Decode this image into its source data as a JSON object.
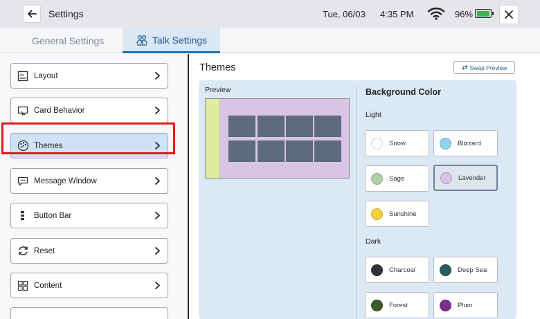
{
  "topbar": {
    "title": "Settings",
    "date": "Tue, 06/03",
    "time": "4:35 PM",
    "battery": "96%",
    "battery_level": 0.96
  },
  "tabs": [
    {
      "label": "General Settings",
      "active": false
    },
    {
      "label": "Talk Settings",
      "active": true
    }
  ],
  "sidebar": {
    "items": [
      {
        "label": "Layout",
        "icon": "layout-icon"
      },
      {
        "label": "Card Behavior",
        "icon": "card-behavior-icon"
      },
      {
        "label": "Themes",
        "icon": "palette-icon",
        "selected": true
      },
      {
        "label": "Message Window",
        "icon": "message-icon"
      },
      {
        "label": "Button Bar",
        "icon": "button-bar-icon"
      },
      {
        "label": "Reset",
        "icon": "reset-icon"
      },
      {
        "label": "Content",
        "icon": "content-icon"
      }
    ]
  },
  "main": {
    "title": "Themes",
    "swap_label": "Swap Preview",
    "preview_label": "Preview",
    "background_title": "Background Color",
    "light_label": "Light",
    "dark_label": "Dark",
    "light_colors": [
      {
        "name": "Snow",
        "color": "#ffffff"
      },
      {
        "name": "Blizzard",
        "color": "#8fd3e8"
      },
      {
        "name": "Sage",
        "color": "#b3cfa8"
      },
      {
        "name": "Lavender",
        "color": "#d6c3e6",
        "selected": true
      },
      {
        "name": "Sunshine",
        "color": "#f4d03f"
      }
    ],
    "dark_colors": [
      {
        "name": "Charcoal",
        "color": "#2f3338"
      },
      {
        "name": "Deep Sea",
        "color": "#2b5a5c"
      },
      {
        "name": "Forest",
        "color": "#3e5a2a"
      },
      {
        "name": "Plum",
        "color": "#7b2f8a"
      }
    ],
    "preview_colors": {
      "background": "#d8c4e6",
      "strip": "#dfee9c",
      "cell": "#5d6a80"
    }
  },
  "colors": {
    "accent": "#1d6fb0",
    "highlight": "#e01b1b"
  }
}
